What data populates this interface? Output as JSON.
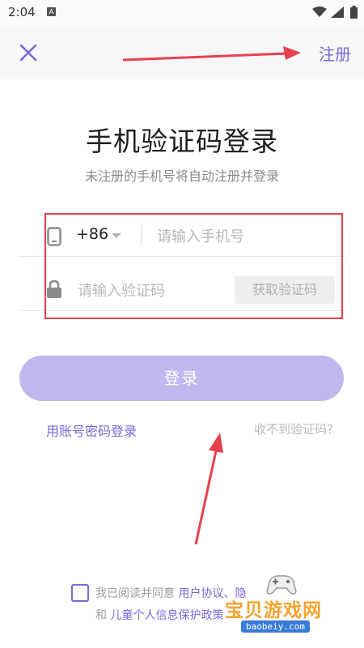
{
  "status_bar": {
    "time": "2:04",
    "app_icon_letter": "A"
  },
  "header": {
    "register_label": "注册"
  },
  "title": "手机验证码登录",
  "subtitle": "未注册的手机号将自动注册并登录",
  "form": {
    "country_code": "+86",
    "phone_placeholder": "请输入手机号",
    "code_placeholder": "请输入验证码",
    "get_code_label": "获取验证码"
  },
  "login_button": "登录",
  "links": {
    "password_login": "用账号密码登录",
    "no_code": "收不到验证码?"
  },
  "agreement": {
    "prefix": "我已阅读并同意 ",
    "user_agreement": "用户协议",
    "middle": "、",
    "privacy_fragment": "隐",
    "and": "和 ",
    "child_privacy": "儿童个人信息保护政策"
  },
  "watermark": {
    "title": "宝贝游戏网",
    "domain": "baobeiy.com"
  },
  "colors": {
    "accent": "#7b67d9",
    "login_button": "#c1b7ee",
    "annotation_red": "#e8404c"
  },
  "icons": [
    "close-icon",
    "phone-icon",
    "lock-icon",
    "wifi-icon",
    "signal-icon",
    "battery-icon"
  ]
}
